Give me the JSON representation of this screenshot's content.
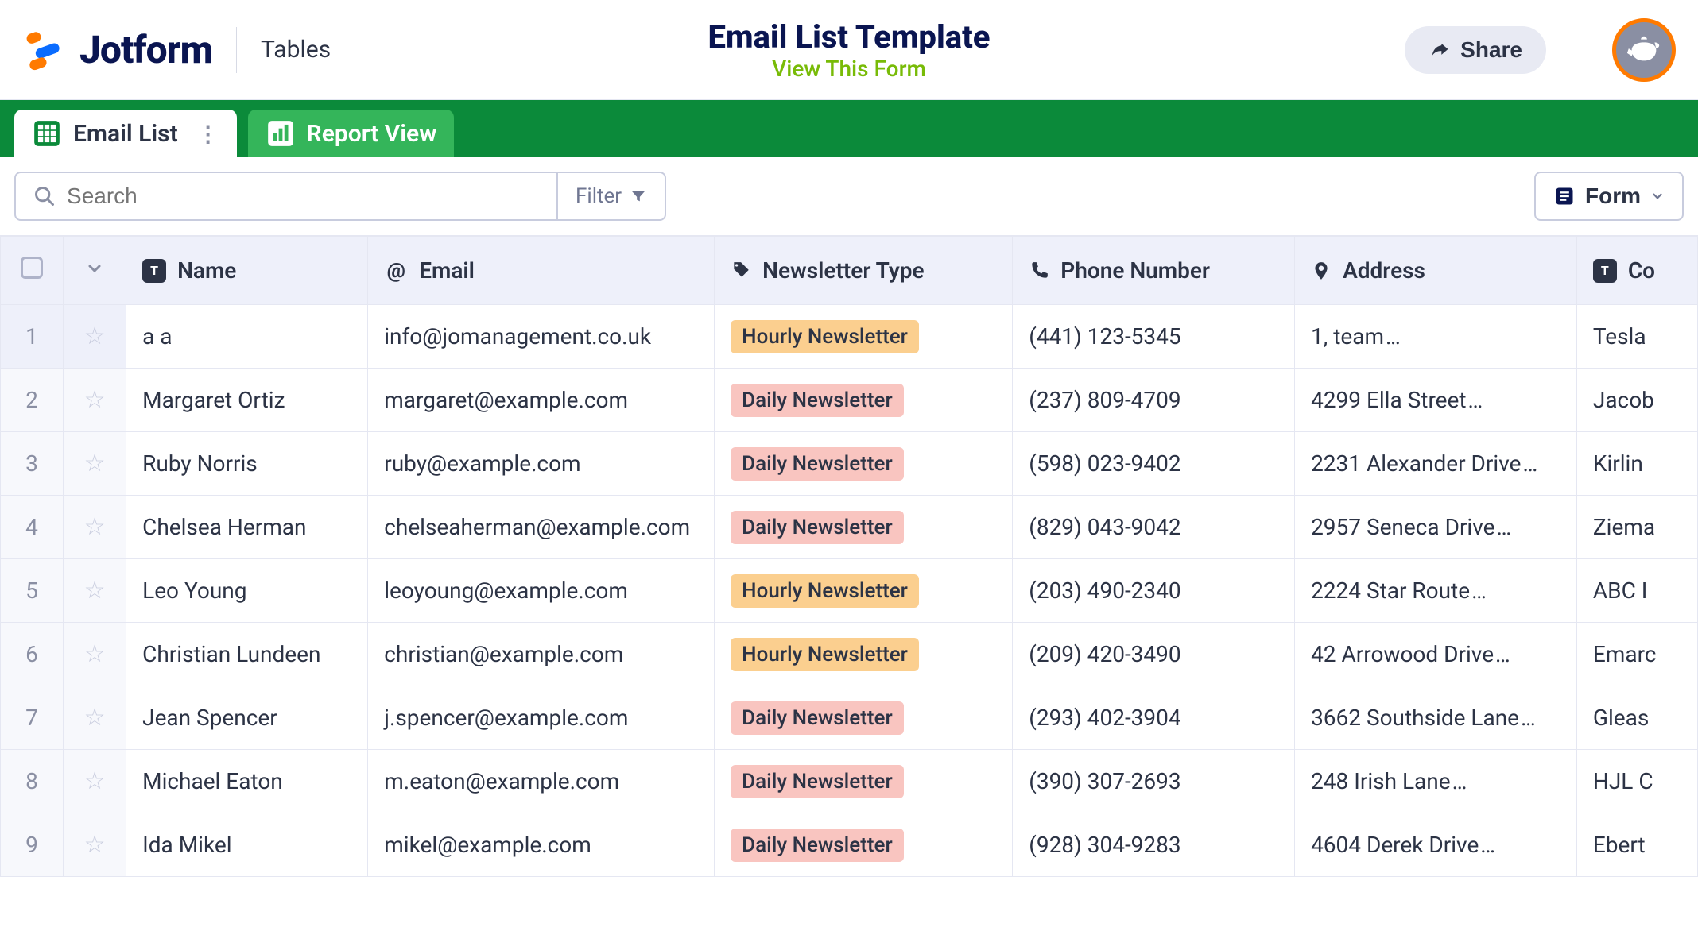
{
  "header": {
    "brand": "Jotform",
    "section": "Tables",
    "title": "Email List Template",
    "view_form": "View This Form",
    "share": "Share"
  },
  "tabs": {
    "email_list": "Email List",
    "report_view": "Report View"
  },
  "toolbar": {
    "search_placeholder": "Search",
    "filter": "Filter",
    "form": "Form"
  },
  "columns": {
    "name": "Name",
    "email": "Email",
    "newsletter": "Newsletter Type",
    "phone": "Phone Number",
    "address": "Address",
    "company": "Co"
  },
  "newsletter_types": {
    "hourly": "Hourly Newsletter",
    "daily": "Daily Newsletter"
  },
  "rows": [
    {
      "idx": "1",
      "name": "a a",
      "email": "info@jomanagement.co.uk",
      "type": "hourly",
      "phone": "(441) 123-5345",
      "address": "1, team",
      "company": "Tesla"
    },
    {
      "idx": "2",
      "name": "Margaret Ortiz",
      "email": "margaret@example.com",
      "type": "daily",
      "phone": "(237) 809-4709",
      "address": "4299 Ella Street",
      "company": "Jacob"
    },
    {
      "idx": "3",
      "name": "Ruby Norris",
      "email": "ruby@example.com",
      "type": "daily",
      "phone": "(598) 023-9402",
      "address": "2231 Alexander Drive",
      "company": "Kirlin"
    },
    {
      "idx": "4",
      "name": "Chelsea Herman",
      "email": "chelseaherman@example.com",
      "type": "daily",
      "phone": "(829) 043-9042",
      "address": "2957 Seneca Drive",
      "company": "Ziema"
    },
    {
      "idx": "5",
      "name": "Leo Young",
      "email": "leoyoung@example.com",
      "type": "hourly",
      "phone": "(203) 490-2340",
      "address": "2224 Star Route",
      "company": "ABC I"
    },
    {
      "idx": "6",
      "name": "Christian Lundeen",
      "email": "christian@example.com",
      "type": "hourly",
      "phone": "(209) 420-3490",
      "address": "42 Arrowood Drive",
      "company": "Emarc"
    },
    {
      "idx": "7",
      "name": "Jean Spencer",
      "email": "j.spencer@example.com",
      "type": "daily",
      "phone": "(293) 402-3904",
      "address": "3662 Southside Lane",
      "company": "Gleas"
    },
    {
      "idx": "8",
      "name": "Michael Eaton",
      "email": "m.eaton@example.com",
      "type": "daily",
      "phone": "(390) 307-2693",
      "address": "248 Irish Lane",
      "company": "HJL C"
    },
    {
      "idx": "9",
      "name": "Ida Mikel",
      "email": "mikel@example.com",
      "type": "daily",
      "phone": "(928) 304-9283",
      "address": "4604 Derek Drive",
      "company": "Ebert"
    }
  ]
}
